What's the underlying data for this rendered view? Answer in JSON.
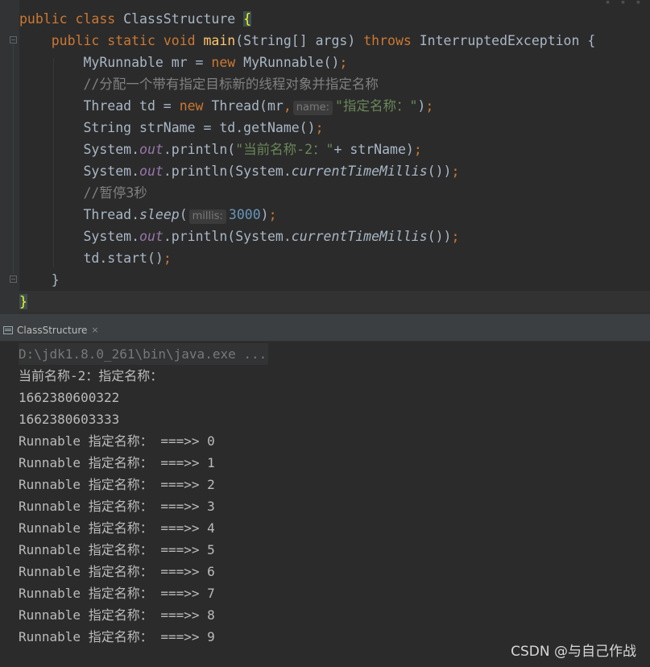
{
  "editor": {
    "lines": [
      {
        "tokens": [
          {
            "t": "public class ",
            "c": "kw"
          },
          {
            "t": "ClassStructure ",
            "c": ""
          },
          {
            "t": "{",
            "c": "brace-hl"
          }
        ]
      },
      {
        "tokens": [
          {
            "t": "    ",
            "c": ""
          },
          {
            "t": "public static void ",
            "c": "kw"
          },
          {
            "t": "main",
            "c": "fn"
          },
          {
            "t": "(String[] args) ",
            "c": ""
          },
          {
            "t": "throws ",
            "c": "kw"
          },
          {
            "t": "InterruptedException {",
            "c": ""
          }
        ]
      },
      {
        "tokens": [
          {
            "t": "        MyRunnable mr = ",
            "c": ""
          },
          {
            "t": "new ",
            "c": "kw"
          },
          {
            "t": "MyRunnable()",
            "c": ""
          },
          {
            "t": ";",
            "c": "kw"
          }
        ]
      },
      {
        "tokens": [
          {
            "t": "        ",
            "c": ""
          },
          {
            "t": "//分配一个带有指定目标新的线程对象并指定名称",
            "c": "cmt"
          }
        ]
      },
      {
        "tokens": [
          {
            "t": "        Thread td = ",
            "c": ""
          },
          {
            "t": "new ",
            "c": "kw"
          },
          {
            "t": "Thread(mr",
            "c": ""
          },
          {
            "t": ",",
            "c": "kw"
          },
          {
            "t": "name:",
            "c": "hint"
          },
          {
            "t": "\"指定名称：\"",
            "c": "str"
          },
          {
            "t": ")",
            "c": ""
          },
          {
            "t": ";",
            "c": "kw"
          }
        ]
      },
      {
        "tokens": [
          {
            "t": "        String strName = td.getName()",
            "c": ""
          },
          {
            "t": ";",
            "c": "kw"
          }
        ]
      },
      {
        "tokens": [
          {
            "t": "        System.",
            "c": ""
          },
          {
            "t": "out",
            "c": "fld"
          },
          {
            "t": ".println(",
            "c": ""
          },
          {
            "t": "\"当前名称-2：\"",
            "c": "str"
          },
          {
            "t": "+ strName)",
            "c": ""
          },
          {
            "t": ";",
            "c": "kw"
          }
        ]
      },
      {
        "tokens": [
          {
            "t": "        System.",
            "c": ""
          },
          {
            "t": "out",
            "c": "fld"
          },
          {
            "t": ".println(System.",
            "c": ""
          },
          {
            "t": "currentTimeMillis",
            "c": "ital"
          },
          {
            "t": "())",
            "c": ""
          },
          {
            "t": ";",
            "c": "kw"
          }
        ]
      },
      {
        "tokens": [
          {
            "t": "        ",
            "c": ""
          },
          {
            "t": "//暂停3秒",
            "c": "cmt"
          }
        ]
      },
      {
        "tokens": [
          {
            "t": "        Thread.",
            "c": ""
          },
          {
            "t": "sleep",
            "c": "ital"
          },
          {
            "t": "(",
            "c": ""
          },
          {
            "t": "millis:",
            "c": "hint"
          },
          {
            "t": "3000",
            "c": "num"
          },
          {
            "t": ")",
            "c": ""
          },
          {
            "t": ";",
            "c": "kw"
          }
        ]
      },
      {
        "tokens": [
          {
            "t": "        System.",
            "c": ""
          },
          {
            "t": "out",
            "c": "fld"
          },
          {
            "t": ".println(System.",
            "c": ""
          },
          {
            "t": "currentTimeMillis",
            "c": "ital"
          },
          {
            "t": "())",
            "c": ""
          },
          {
            "t": ";",
            "c": "kw"
          }
        ]
      },
      {
        "tokens": [
          {
            "t": "        td.start()",
            "c": ""
          },
          {
            "t": ";",
            "c": "kw"
          }
        ]
      },
      {
        "tokens": [
          {
            "t": "    }",
            "c": ""
          }
        ]
      },
      {
        "tokens": [
          {
            "t": "}",
            "c": "brace-hl"
          }
        ]
      }
    ]
  },
  "run_tab": {
    "label": "ClassStructure",
    "close_glyph": "×"
  },
  "console": {
    "command": "D:\\jdk1.8.0_261\\bin\\java.exe ...",
    "lines": [
      "当前名称-2：指定名称：",
      "1662380600322",
      "1662380603333",
      "Runnable 指定名称： ===>> 0",
      "Runnable 指定名称： ===>> 1",
      "Runnable 指定名称： ===>> 2",
      "Runnable 指定名称： ===>> 3",
      "Runnable 指定名称： ===>> 4",
      "Runnable 指定名称： ===>> 5",
      "Runnable 指定名称： ===>> 6",
      "Runnable 指定名称： ===>> 7",
      "Runnable 指定名称： ===>> 8",
      "Runnable 指定名称： ===>> 9"
    ]
  },
  "watermark": "CSDN @与自己作战",
  "colors": {
    "background": "#2b2b2b",
    "keyword": "#cc7832",
    "method": "#ffc66d",
    "string": "#6a8759",
    "number": "#6897bb",
    "field": "#9876aa",
    "comment": "#808080",
    "text": "#a9b7c6"
  },
  "icons": [
    "fold-marker-icon",
    "terminal-icon",
    "close-icon"
  ]
}
